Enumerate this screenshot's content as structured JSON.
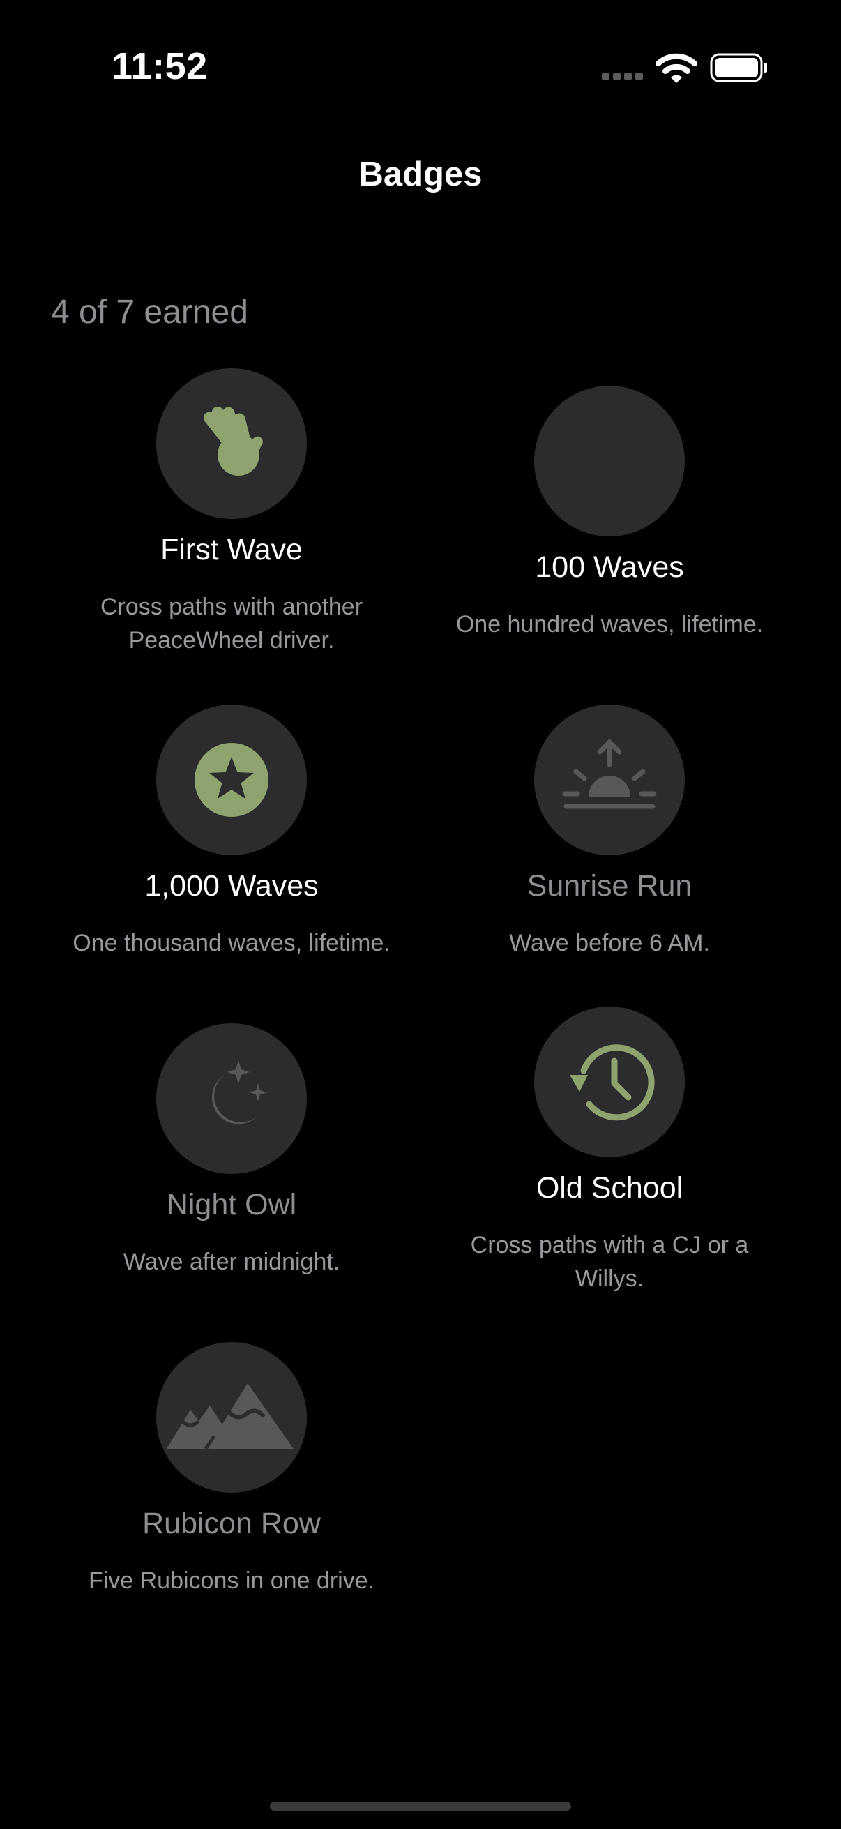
{
  "status_bar": {
    "time": "11:52"
  },
  "nav": {
    "title": "Badges"
  },
  "summary": {
    "earned_text": "4 of 7 earned"
  },
  "colors": {
    "accent": "#8fa36e",
    "locked_icon": "#58585a",
    "circle": "#2c2c2e"
  },
  "badges": [
    {
      "name": "First Wave",
      "description": "Cross paths with another PeaceWheel driver.",
      "icon": "waving-hand-icon",
      "earned": true
    },
    {
      "name": "100 Waves",
      "description": "One hundred waves, lifetime.",
      "icon": "none",
      "earned": true
    },
    {
      "name": "1,000 Waves",
      "description": "One thousand waves, lifetime.",
      "icon": "star-circle-icon",
      "earned": true
    },
    {
      "name": "Sunrise Run",
      "description": "Wave before 6 AM.",
      "icon": "sunrise-icon",
      "earned": false
    },
    {
      "name": "Night Owl",
      "description": "Wave after midnight.",
      "icon": "moon-stars-icon",
      "earned": false
    },
    {
      "name": "Old School",
      "description": "Cross paths with a CJ or a Willys.",
      "icon": "clock-history-icon",
      "earned": true
    },
    {
      "name": "Rubicon Row",
      "description": "Five Rubicons in one drive.",
      "icon": "mountains-icon",
      "earned": false
    }
  ]
}
